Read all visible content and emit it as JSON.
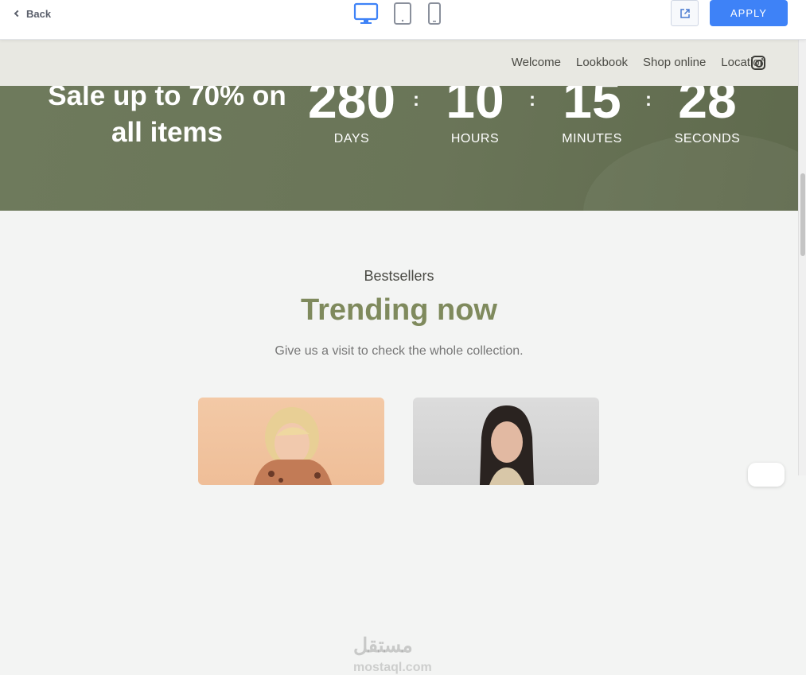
{
  "toolbar": {
    "back_label": "Back",
    "apply_label": "APPLY",
    "devices": [
      "desktop-icon",
      "tablet-icon",
      "mobile-icon"
    ],
    "accent": "#3e82f7"
  },
  "nav": {
    "links": [
      "Welcome",
      "Lookbook",
      "Shop online",
      "Location"
    ],
    "social_icon": "instagram-icon"
  },
  "hero": {
    "sale_text": "Sale up to 70% on all items",
    "countdown": [
      {
        "value": "280",
        "label": "DAYS"
      },
      {
        "value": "10",
        "label": "HOURS"
      },
      {
        "value": "15",
        "label": "MINUTES"
      },
      {
        "value": "28",
        "label": "SECONDS"
      }
    ],
    "separator": ":"
  },
  "section": {
    "eyebrow": "Bestsellers",
    "title": "Trending now",
    "subtitle": "Give us a visit to check the whole collection."
  },
  "watermark": {
    "arabic": "مستقل",
    "latin": "mostaql.com"
  }
}
